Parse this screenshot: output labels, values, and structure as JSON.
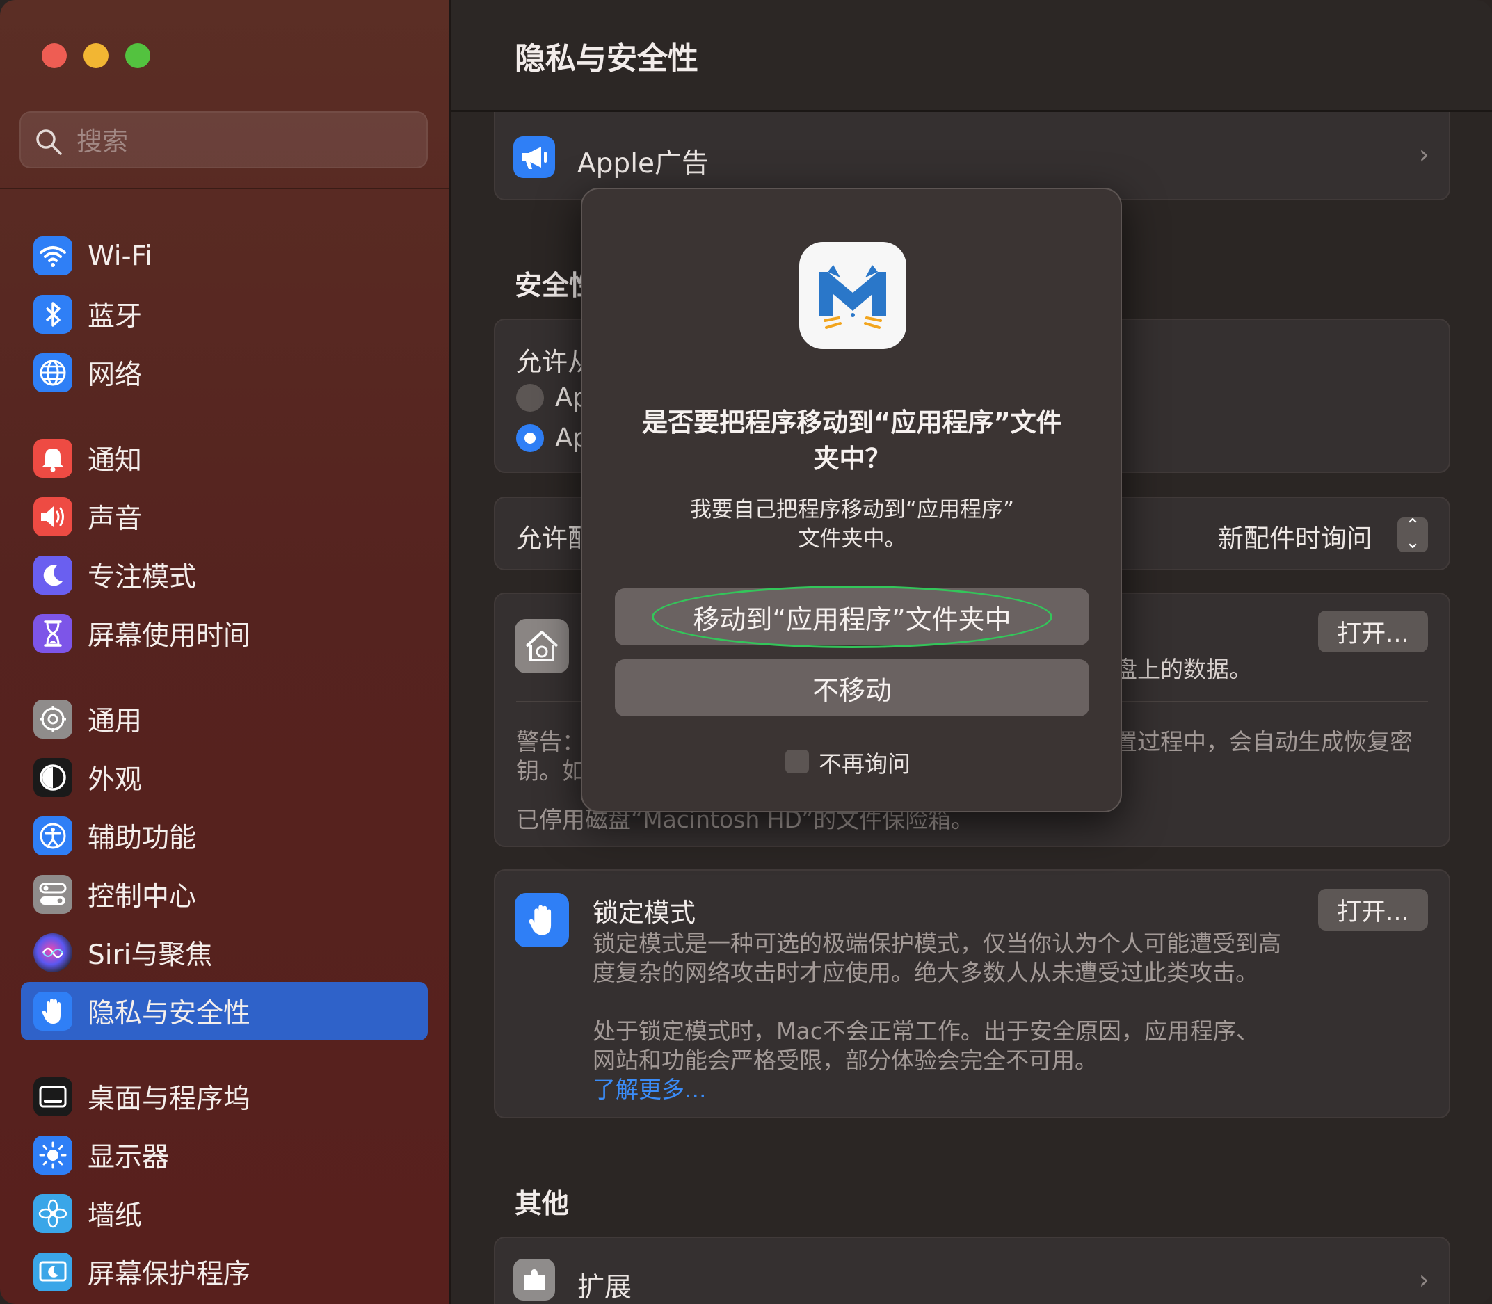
{
  "sidebar": {
    "search_placeholder": "搜索",
    "items": [
      {
        "label": "Wi-Fi",
        "icon": "wifi-icon",
        "color": "#2f7ff6"
      },
      {
        "label": "蓝牙",
        "icon": "bluetooth-icon",
        "color": "#2f7ff6"
      },
      {
        "label": "网络",
        "icon": "globe-icon",
        "color": "#2f7ff6"
      },
      {
        "label": "通知",
        "icon": "bell-icon",
        "color": "#ee4b43"
      },
      {
        "label": "声音",
        "icon": "speaker-icon",
        "color": "#ee4b43"
      },
      {
        "label": "专注模式",
        "icon": "moon-icon",
        "color": "#6a5ff0"
      },
      {
        "label": "屏幕使用时间",
        "icon": "hourglass-icon",
        "color": "#7d55e8"
      },
      {
        "label": "通用",
        "icon": "gear-icon",
        "color": "#8f8c8b"
      },
      {
        "label": "外观",
        "icon": "appearance-icon",
        "color": "#1a1a1a"
      },
      {
        "label": "辅助功能",
        "icon": "accessibility-icon",
        "color": "#2f7ff6"
      },
      {
        "label": "控制中心",
        "icon": "control-center-icon",
        "color": "#8f8c8b"
      },
      {
        "label": "Siri与聚焦",
        "icon": "siri-icon",
        "color": "#3b2a6b"
      },
      {
        "label": "隐私与安全性",
        "icon": "hand-icon",
        "color": "#2f7ff6"
      },
      {
        "label": "桌面与程序坞",
        "icon": "dock-icon",
        "color": "#1a1a1a"
      },
      {
        "label": "显示器",
        "icon": "sun-icon",
        "color": "#2f7ff6"
      },
      {
        "label": "墙纸",
        "icon": "flower-icon",
        "color": "#3aa6e8"
      },
      {
        "label": "屏幕保护程序",
        "icon": "screensaver-icon",
        "color": "#3aa6e8"
      }
    ],
    "active": "隐私与安全性"
  },
  "main": {
    "title": "隐私与安全性",
    "apple_ads": "Apple广告",
    "security_section": "安全性",
    "allow_apps_label": "允许从以下位置下载的应用程序",
    "radio_1": "Ap",
    "radio_2": "Ap",
    "accessories_label": "允许配件连接",
    "accessories_value": "新配件时询问",
    "filevault_open": "打开...",
    "filevault_desc_tail": "盘上的数据。",
    "warning_left": "警告：",
    "warning_right": "置过程中，会自动生成恢复密",
    "warning_line2": "钥。如",
    "filevault_status": "已停用磁盘“Macintosh HD”的文件保险箱。",
    "lockdown_title": "锁定模式",
    "lockdown_open": "打开...",
    "lockdown_desc_1": "锁定模式是一种可选的极端保护模式，仅当你认为个人可能遭受到高",
    "lockdown_desc_2": "度复杂的网络攻击时才应使用。绝大多数人从未遭受过此类攻击。",
    "lockdown_desc_3": "处于锁定模式时，Mac不会正常工作。出于安全原因，应用程序、",
    "lockdown_desc_4": "网站和功能会严格受限，部分体验会完全不可用。",
    "learn_more": "了解更多...",
    "other_section": "其他",
    "extensions": "扩展"
  },
  "dialog": {
    "title_line1": "是否要把程序移动到“应用程序”文件",
    "title_line2": "夹中？",
    "message_line1": "我要自己把程序移动到“应用程序”",
    "message_line2": "文件夹中。",
    "move_button": "移动到“应用程序”文件夹中",
    "dont_move_button": "不移动",
    "dont_ask_label": "不再询问",
    "highlight_color": "#33c65a"
  }
}
